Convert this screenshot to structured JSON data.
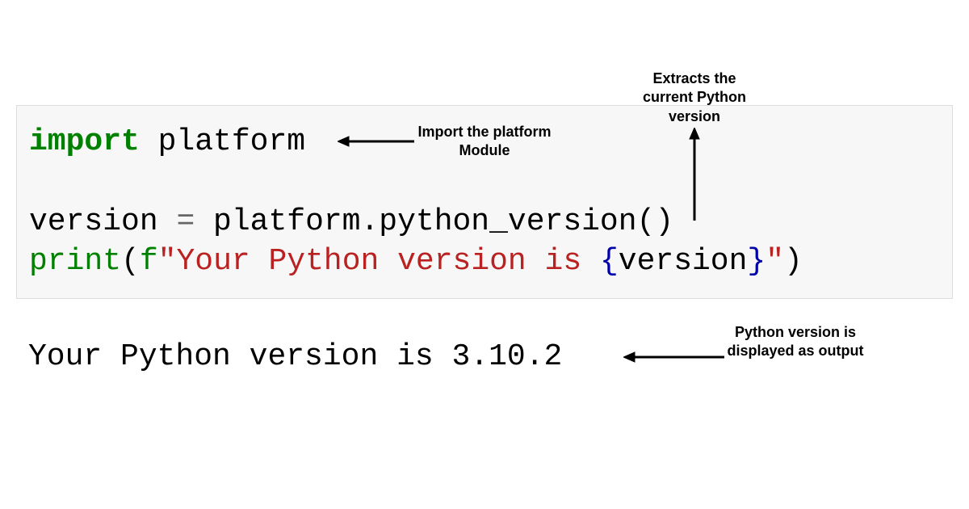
{
  "code": {
    "line1": {
      "keyword": "import",
      "module": " platform"
    },
    "line2": {
      "var": "version ",
      "equals": "=",
      "expr": " platform.python_version()"
    },
    "line3": {
      "func": "print",
      "open": "(",
      "prefix": "f",
      "quote_open": "\"",
      "str1": "Your Python version is ",
      "brace_open": "{",
      "interp": "version",
      "brace_close": "}",
      "quote_close": "\"",
      "close": ")"
    }
  },
  "output": "Your Python version is 3.10.2",
  "annotations": {
    "a1": "Import the platform Module",
    "a2": "Extracts the current Python version",
    "a3": "Python version is displayed as output"
  }
}
